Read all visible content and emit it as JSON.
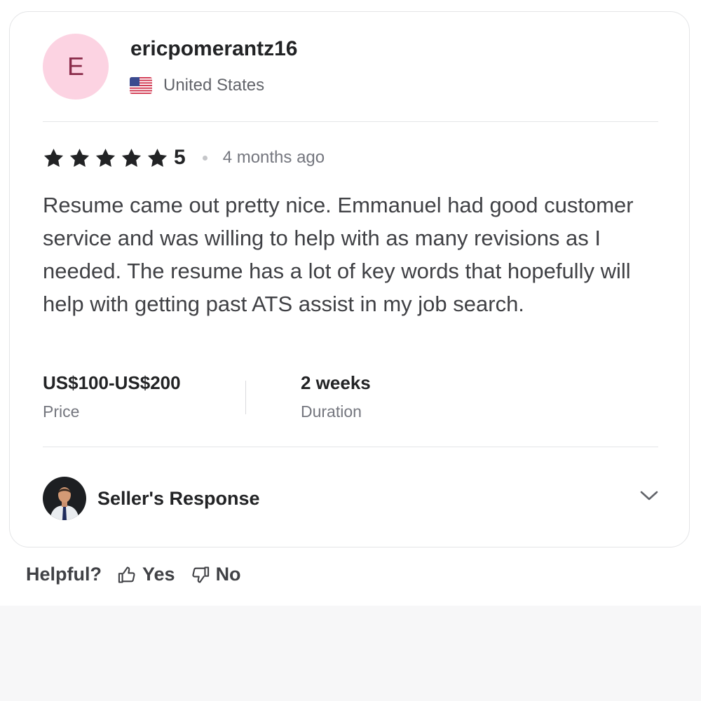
{
  "review": {
    "avatar_initial": "E",
    "username": "ericpomerantz16",
    "country": "United States",
    "country_flag_icon": "us-flag-icon",
    "rating": "5",
    "star_count": 5,
    "time_ago": "4 months ago",
    "text": "Resume came out pretty nice. Emmanuel had good customer service and was willing to help with as many revisions as I needed. The resume has a lot of key words that hopefully will help with getting past ATS assist in my job search.",
    "price": {
      "value": "US$100-US$200",
      "label": "Price"
    },
    "duration": {
      "value": "2 weeks",
      "label": "Duration"
    },
    "seller_response": {
      "title": "Seller's Response",
      "expand_icon": "chevron-down-icon"
    }
  },
  "helpful": {
    "label": "Helpful?",
    "yes_label": "Yes",
    "yes_icon": "thumbs-up-icon",
    "no_label": "No",
    "no_icon": "thumbs-down-icon"
  },
  "colors": {
    "avatar_bg": "#fcd3e2",
    "avatar_text": "#8a2b4a",
    "primary_text": "#222325",
    "secondary_text": "#74767e",
    "border": "#e4e5e7",
    "page_footer_bg": "#f7f7f8"
  }
}
